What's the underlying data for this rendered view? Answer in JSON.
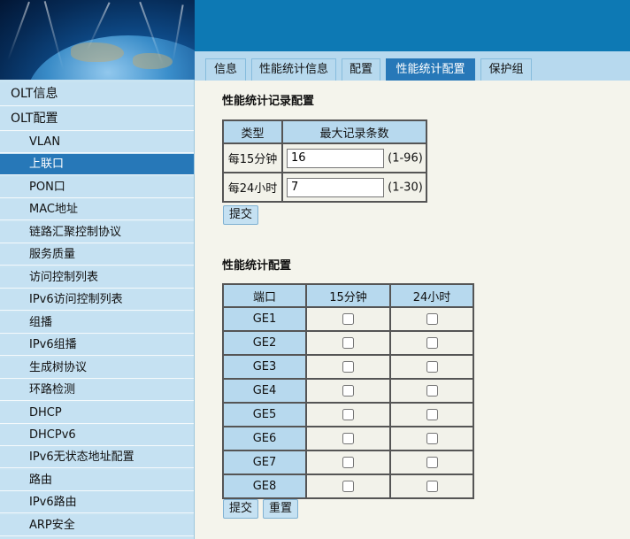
{
  "tabs": [
    {
      "label": "信息"
    },
    {
      "label": "性能统计信息"
    },
    {
      "label": "配置"
    },
    {
      "label": "性能统计配置",
      "active": true
    },
    {
      "label": "保护组"
    }
  ],
  "sidebar": {
    "items": [
      {
        "label": "OLT信息",
        "level": "top"
      },
      {
        "label": "OLT配置",
        "level": "top"
      },
      {
        "label": "VLAN",
        "level": "sub"
      },
      {
        "label": "上联口",
        "level": "sub",
        "active": true
      },
      {
        "label": "PON口",
        "level": "sub"
      },
      {
        "label": "MAC地址",
        "level": "sub"
      },
      {
        "label": "链路汇聚控制协议",
        "level": "sub"
      },
      {
        "label": "服务质量",
        "level": "sub"
      },
      {
        "label": "访问控制列表",
        "level": "sub"
      },
      {
        "label": "IPv6访问控制列表",
        "level": "sub"
      },
      {
        "label": "组播",
        "level": "sub"
      },
      {
        "label": "IPv6组播",
        "level": "sub"
      },
      {
        "label": "生成树协议",
        "level": "sub"
      },
      {
        "label": "环路检测",
        "level": "sub"
      },
      {
        "label": "DHCP",
        "level": "sub"
      },
      {
        "label": "DHCPv6",
        "level": "sub"
      },
      {
        "label": "IPv6无状态地址配置",
        "level": "sub"
      },
      {
        "label": "路由",
        "level": "sub"
      },
      {
        "label": "IPv6路由",
        "level": "sub"
      },
      {
        "label": "ARP安全",
        "level": "sub"
      }
    ]
  },
  "record_config": {
    "title": "性能统计记录配置",
    "col_type": "类型",
    "col_max": "最大记录条数",
    "rows": [
      {
        "label": "每15分钟",
        "value": "16",
        "range": "(1-96)"
      },
      {
        "label": "每24小时",
        "value": "7",
        "range": "(1-30)"
      }
    ],
    "submit_label": "提交"
  },
  "stat_config": {
    "title": "性能统计配置",
    "col_port": "端口",
    "col_15min": "15分钟",
    "col_24h": "24小时",
    "ports": [
      "GE1",
      "GE2",
      "GE3",
      "GE4",
      "GE5",
      "GE6",
      "GE7",
      "GE8"
    ],
    "submit_label": "提交",
    "reset_label": "重置"
  },
  "colors": {
    "header_blue": "#0d79b4",
    "active_blue": "#2778b8",
    "light_blue": "#c5e1f2",
    "page_bg": "#f4f4ec"
  }
}
